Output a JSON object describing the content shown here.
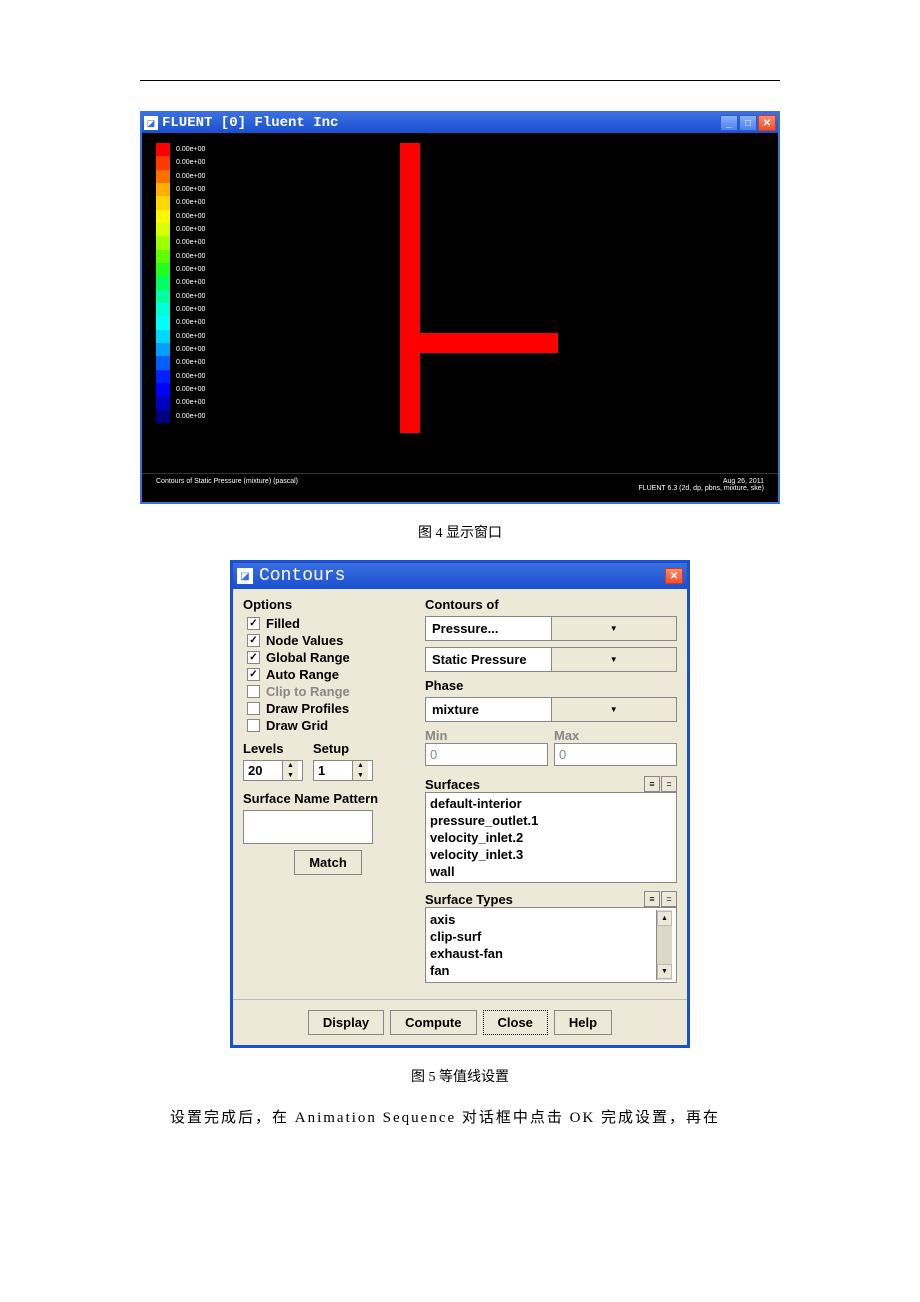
{
  "fluent_window": {
    "title": "FLUENT [0] Fluent Inc",
    "colorbar": {
      "colors": [
        "#ff0000",
        "#ff3a00",
        "#ff7000",
        "#ffb000",
        "#ffd800",
        "#fff800",
        "#d8ff00",
        "#a0ff00",
        "#60ff00",
        "#20ff20",
        "#00ff60",
        "#00ffa0",
        "#00ffd8",
        "#00fff8",
        "#00d8ff",
        "#00a0ff",
        "#0060ff",
        "#0020ff",
        "#0000ff",
        "#0000c0",
        "#000080"
      ],
      "label_value": "0.00e+00",
      "label_count": 21
    },
    "footer_left": "Contours of Static Pressure (mixture) (pascal)",
    "footer_date": "Aug 26, 2011",
    "footer_version": "FLUENT 6.3 (2d, dp, pbns, mixture, ske)"
  },
  "caption4": "图 4 显示窗口",
  "contours": {
    "title": "Contours",
    "options_label": "Options",
    "checkboxes": [
      {
        "label": "Filled",
        "checked": true,
        "enabled": true
      },
      {
        "label": "Node Values",
        "checked": true,
        "enabled": true
      },
      {
        "label": "Global Range",
        "checked": true,
        "enabled": true
      },
      {
        "label": "Auto Range",
        "checked": true,
        "enabled": true
      },
      {
        "label": "Clip to Range",
        "checked": false,
        "enabled": false
      },
      {
        "label": "Draw Profiles",
        "checked": false,
        "enabled": true
      },
      {
        "label": "Draw Grid",
        "checked": false,
        "enabled": true
      }
    ],
    "levels_label": "Levels",
    "levels_value": "20",
    "setup_label": "Setup",
    "setup_value": "1",
    "pattern_label": "Surface Name Pattern",
    "match_btn": "Match",
    "contours_of_label": "Contours of",
    "select1": "Pressure...",
    "select2": "Static Pressure",
    "phase_label": "Phase",
    "phase_value": "mixture",
    "min_label": "Min",
    "min_value": "0",
    "max_label": "Max",
    "max_value": "0",
    "surfaces_label": "Surfaces",
    "surfaces_list": [
      "default-interior",
      "pressure_outlet.1",
      "velocity_inlet.2",
      "velocity_inlet.3",
      "wall"
    ],
    "surface_types_label": "Surface Types",
    "surface_types_list": [
      "axis",
      "clip-surf",
      "exhaust-fan",
      "fan"
    ],
    "btn_display": "Display",
    "btn_compute": "Compute",
    "btn_close": "Close",
    "btn_help": "Help"
  },
  "caption5": "图 5 等值线设置",
  "body_text": "设置完成后，在 Animation Sequence 对话框中点击 OK 完成设置，再在"
}
